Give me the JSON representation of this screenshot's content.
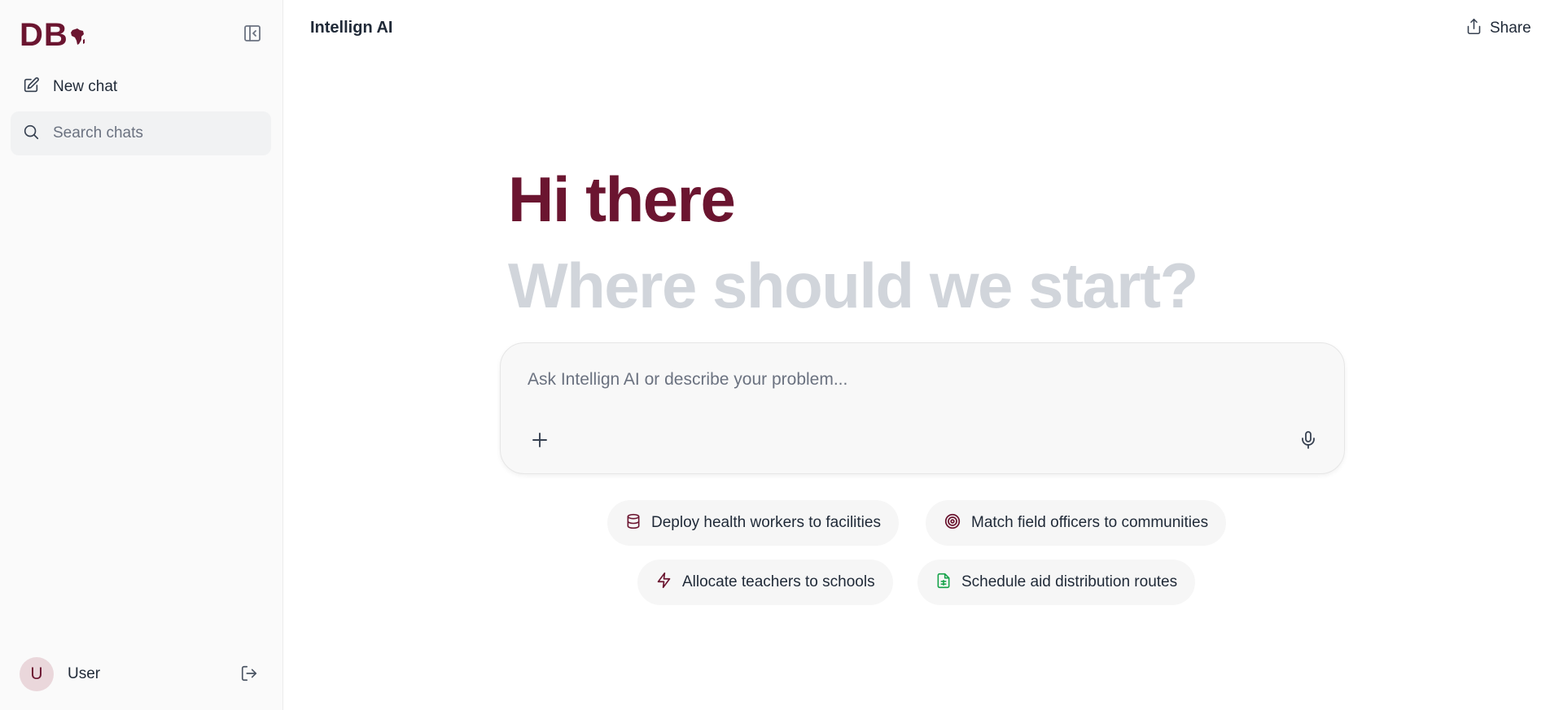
{
  "sidebar": {
    "logo_text": "DB",
    "new_chat_label": "New chat",
    "search_placeholder": "Search chats",
    "user": {
      "initial": "U",
      "name": "User"
    }
  },
  "header": {
    "title": "Intellign AI",
    "share_label": "Share"
  },
  "hero": {
    "greeting": "Hi there",
    "prompt": "Where should we start?"
  },
  "composer": {
    "placeholder": "Ask Intellign AI or describe your problem...",
    "value": ""
  },
  "suggestions": [
    {
      "label": "Deploy health workers to facilities",
      "icon": "database-icon",
      "color": "#6b1530"
    },
    {
      "label": "Match field officers to communities",
      "icon": "target-icon",
      "color": "#6b1530"
    },
    {
      "label": "Allocate teachers to schools",
      "icon": "lightning-icon",
      "color": "#6b1530"
    },
    {
      "label": "Schedule aid distribution routes",
      "icon": "spreadsheet-icon",
      "color": "#16a34a"
    }
  ],
  "colors": {
    "brand": "#6b1530",
    "hero_muted": "#d1d5db",
    "sidebar_bg": "#fafafa",
    "sheet_green": "#16a34a"
  }
}
